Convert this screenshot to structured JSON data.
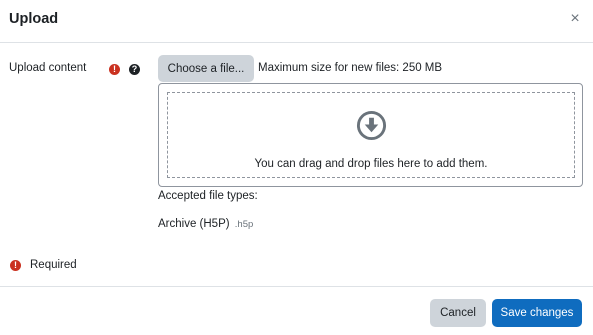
{
  "modal": {
    "title": "Upload",
    "close_symbol": "×"
  },
  "form": {
    "field_label": "Upload content",
    "required_icon": "!",
    "help_icon": "?",
    "choose_file_label": "Choose a file...",
    "max_size_text": "Maximum size for new files: 250 MB",
    "dropzone_text": "You can drag and drop files here to add them.",
    "accepted_label": "Accepted file types:",
    "accepted_types": [
      {
        "name": "Archive (H5P)",
        "ext": ".h5p"
      }
    ],
    "required_note": "Required"
  },
  "footer": {
    "cancel_label": "Cancel",
    "save_label": "Save changes"
  },
  "colors": {
    "primary": "#0f6cbf",
    "danger": "#ca3120",
    "secondary_button": "#ced4da"
  },
  "icons": [
    "close-icon",
    "required-icon",
    "help-icon",
    "download-arrow-icon"
  ]
}
